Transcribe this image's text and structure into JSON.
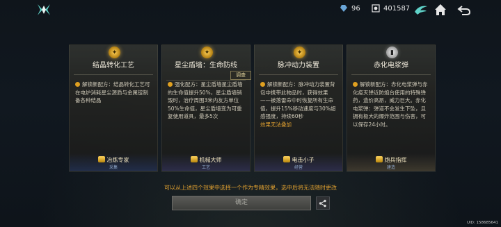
{
  "header": {
    "currency1": {
      "icon": "crystal-icon",
      "value": "96"
    },
    "currency2": {
      "icon": "coin-icon",
      "value": "401587"
    }
  },
  "cards": [
    {
      "emblem": "gold",
      "title": "结晶转化工艺",
      "desc": "解锁新配方：结晶转化工艺可在电炉消耗星尘源质与金属锭制备各种结晶",
      "warn": "",
      "specialist": "冶炼专家",
      "role": "采集"
    },
    {
      "emblem": "gold",
      "title": "星尘盾墙：生命防线",
      "tag": "调查",
      "desc": "强化配方：星尘盾墙星尘盾墙的生命值提升50%，星尘盾墙销毁时，治疗周围3米内友方单位50%生命值，星尘盾墙变为可重复使用道具，最多5次",
      "warn": "",
      "specialist": "机械大师",
      "role": "工艺"
    },
    {
      "emblem": "gold",
      "title": "脉冲动力装置",
      "desc": "解锁新配方：脉冲动力装置背包中携带此物品时，获得效果——被落雷命中时恢复所有生命值，提升15%移动速度与30%超感强度，持续60秒",
      "warn": "效果无法叠加",
      "specialist": "电击小子",
      "role": "经营"
    },
    {
      "emblem": "silver",
      "title": "赤化电浆弹",
      "desc": "解锁新配方：赤化电浆弹与赤化疫灭弹近防炮台使用的特殊弹药，造价高昂，威力巨大。赤化电浆弹：弹道不会发生下坠，且拥有极大的爆炸范围与伤害，可以保存24小时。",
      "warn": "",
      "specialist": "炮兵指挥",
      "role": "建造"
    }
  ],
  "notice": "可以从上述四个效果中选择一个作为专精效果，选中后将无法随时更改",
  "confirm_label": "确定",
  "uid": "UID: 158685641",
  "colors": {
    "accent": "#e0a030",
    "panel": "#262622"
  }
}
